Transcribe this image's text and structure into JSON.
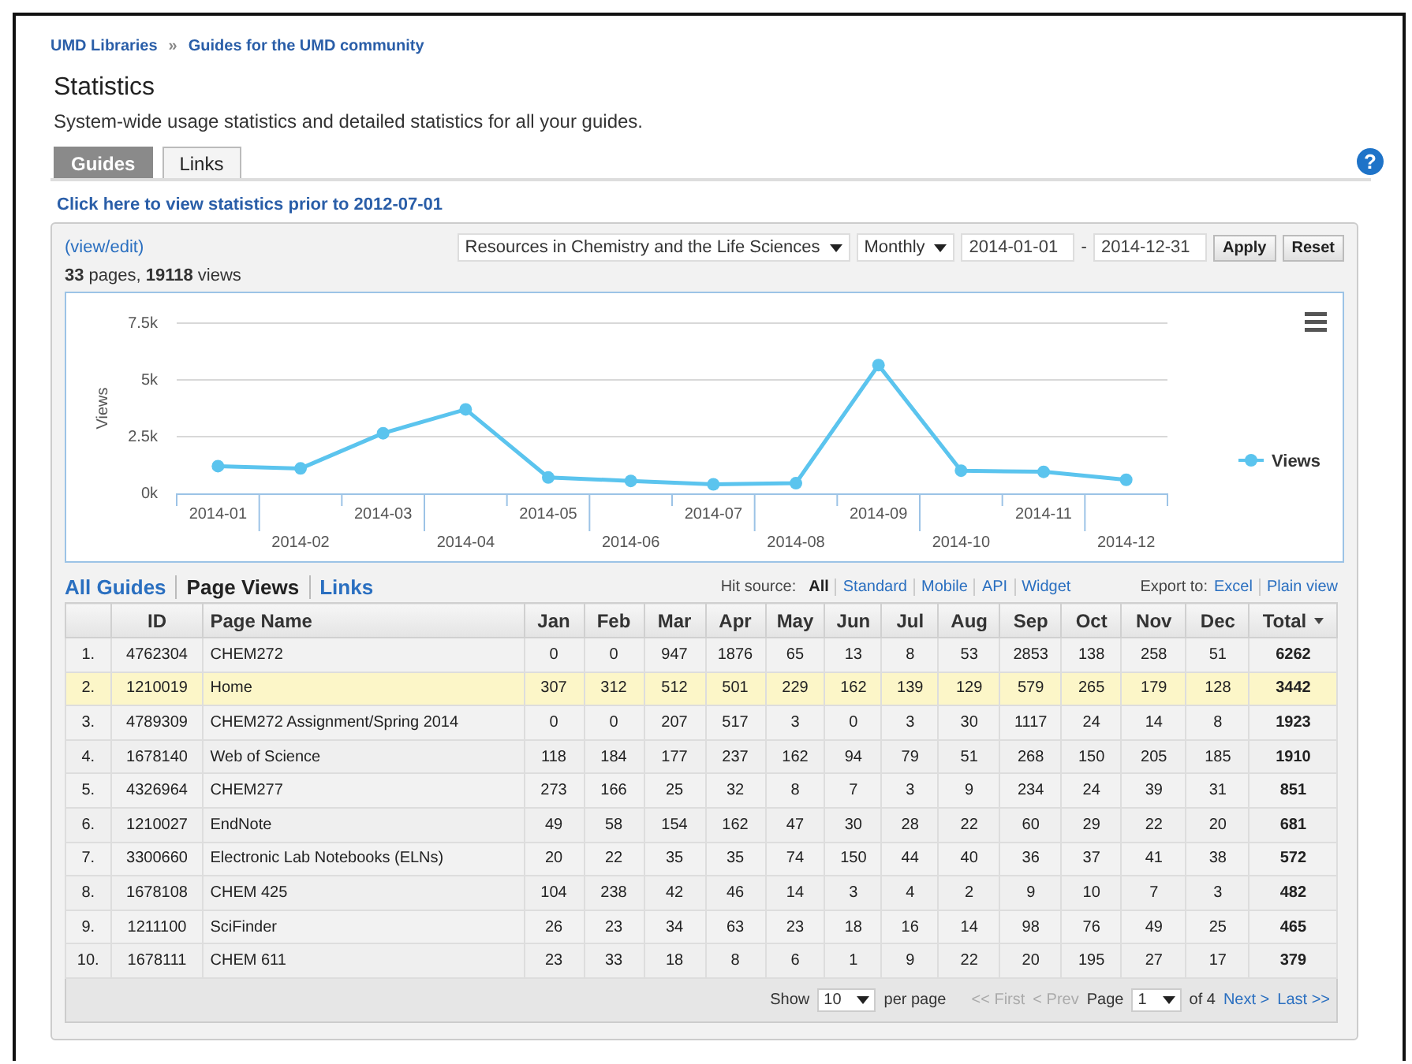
{
  "breadcrumb": {
    "items": [
      "UMD Libraries",
      "Guides for the UMD community"
    ],
    "separator": "»"
  },
  "title": "Statistics",
  "description": "System-wide usage statistics and detailed statistics for all your guides.",
  "tabs": [
    {
      "label": "Guides",
      "selected": true
    },
    {
      "label": "Links",
      "selected": false
    }
  ],
  "help_icon": "?",
  "prior_link": "Click here to view statistics prior to 2012-07-01",
  "view_edit": "(view/edit)",
  "summary": "**33** pages, **19118** views",
  "filters": {
    "guide": "Resources in Chemistry and the Life Sciences",
    "period": "Monthly",
    "date_from": "2014-01-01",
    "date_separator": "-",
    "date_to": "2014-12-31",
    "buttons": [
      "Apply",
      "Reset"
    ]
  },
  "chart": {
    "chart_data": {
      "type": "line",
      "ylabel": "Views",
      "categories": [
        "2014-01",
        "2014-02",
        "2014-03",
        "2014-04",
        "2014-05",
        "2014-06",
        "2014-07",
        "2014-08",
        "2014-09",
        "2014-10",
        "2014-11",
        "2014-12"
      ],
      "series": [
        {
          "name": "Views",
          "color": "#5bc4ee",
          "marker": "circle",
          "values": [
            1200,
            1100,
            2650,
            3700,
            700,
            550,
            400,
            450,
            5650,
            1000,
            950,
            600
          ]
        }
      ],
      "ylim": [
        0,
        7500
      ],
      "yticks": [
        {
          "value": 0,
          "label": "0k"
        },
        {
          "value": 2500,
          "label": "2.5k"
        },
        {
          "value": 5000,
          "label": "5k"
        },
        {
          "value": 7500,
          "label": "7.5k"
        }
      ]
    }
  },
  "report_tabs": [
    {
      "label": "All Guides",
      "selected": false
    },
    {
      "label": "Page Views",
      "selected": true
    },
    {
      "label": "Links",
      "selected": false
    }
  ],
  "hit_source": {
    "label": "Hit source:",
    "options": [
      {
        "label": "All",
        "selected": true
      },
      {
        "label": "Standard",
        "selected": false
      },
      {
        "label": "Mobile",
        "selected": false
      },
      {
        "label": "API",
        "selected": false
      },
      {
        "label": "Widget",
        "selected": false
      }
    ]
  },
  "export": {
    "label": "Export to:",
    "links": [
      "Excel",
      "Plain view"
    ]
  },
  "table": {
    "columns": [
      {
        "sorted": false
      },
      {
        "label": "ID",
        "sorted": false
      },
      {
        "label": "Page Name",
        "sorted": false
      },
      {
        "label": "Jan",
        "sorted": false
      },
      {
        "label": "Feb",
        "sorted": false
      },
      {
        "label": "Mar",
        "sorted": false
      },
      {
        "label": "Apr",
        "sorted": false
      },
      {
        "label": "May",
        "sorted": false
      },
      {
        "label": "Jun",
        "sorted": false
      },
      {
        "label": "Jul",
        "sorted": false
      },
      {
        "label": "Aug",
        "sorted": false
      },
      {
        "label": "Sep",
        "sorted": false
      },
      {
        "label": "Oct",
        "sorted": false
      },
      {
        "label": "Nov",
        "sorted": false
      },
      {
        "label": "Dec",
        "sorted": false
      },
      {
        "label": "Total",
        "sorted": true
      }
    ],
    "rows": [
      {
        "index": "1.",
        "id": "4762304",
        "name": "CHEM272",
        "values": [
          "0",
          "0",
          "947",
          "1876",
          "65",
          "13",
          "8",
          "53",
          "2853",
          "138",
          "258",
          "51"
        ],
        "total": "6262",
        "selected": false
      },
      {
        "index": "2.",
        "id": "1210019",
        "name": "Home",
        "values": [
          "307",
          "312",
          "512",
          "501",
          "229",
          "162",
          "139",
          "129",
          "579",
          "265",
          "179",
          "128"
        ],
        "total": "3442",
        "selected": true
      },
      {
        "index": "3.",
        "id": "4789309",
        "name": "CHEM272 Assignment/Spring 2014",
        "values": [
          "0",
          "0",
          "207",
          "517",
          "3",
          "0",
          "3",
          "30",
          "1117",
          "24",
          "14",
          "8"
        ],
        "total": "1923",
        "selected": false
      },
      {
        "index": "4.",
        "id": "1678140",
        "name": "Web of Science",
        "values": [
          "118",
          "184",
          "177",
          "237",
          "162",
          "94",
          "79",
          "51",
          "268",
          "150",
          "205",
          "185"
        ],
        "total": "1910",
        "selected": false
      },
      {
        "index": "5.",
        "id": "4326964",
        "name": "CHEM277",
        "values": [
          "273",
          "166",
          "25",
          "32",
          "8",
          "7",
          "3",
          "9",
          "234",
          "24",
          "39",
          "31"
        ],
        "total": "851",
        "selected": false
      },
      {
        "index": "6.",
        "id": "1210027",
        "name": "EndNote",
        "values": [
          "49",
          "58",
          "154",
          "162",
          "47",
          "30",
          "28",
          "22",
          "60",
          "29",
          "22",
          "20"
        ],
        "total": "681",
        "selected": false
      },
      {
        "index": "7.",
        "id": "3300660",
        "name": "Electronic Lab Notebooks (ELNs)",
        "values": [
          "20",
          "22",
          "35",
          "35",
          "74",
          "150",
          "44",
          "40",
          "36",
          "37",
          "41",
          "38"
        ],
        "total": "572",
        "selected": false
      },
      {
        "index": "8.",
        "id": "1678108",
        "name": "CHEM 425",
        "values": [
          "104",
          "238",
          "42",
          "46",
          "14",
          "3",
          "4",
          "2",
          "9",
          "10",
          "7",
          "3"
        ],
        "total": "482",
        "selected": false
      },
      {
        "index": "9.",
        "id": "1211100",
        "name": "SciFinder",
        "values": [
          "26",
          "23",
          "34",
          "63",
          "23",
          "18",
          "16",
          "14",
          "98",
          "76",
          "49",
          "25"
        ],
        "total": "465",
        "selected": false
      },
      {
        "index": "10.",
        "id": "1678111",
        "name": "CHEM 611",
        "values": [
          "23",
          "33",
          "18",
          "8",
          "6",
          "1",
          "9",
          "22",
          "20",
          "195",
          "27",
          "17"
        ],
        "total": "379",
        "selected": false
      }
    ]
  },
  "pagination": {
    "show_label": "Show",
    "page_size": "10",
    "per_page_label": "per page",
    "first": "<< First",
    "prev": "< Prev",
    "page_label": "Page",
    "page": "1",
    "of_label": "of 4",
    "next": "Next >",
    "last": "Last >>",
    "first_disabled": true,
    "prev_disabled": true
  }
}
